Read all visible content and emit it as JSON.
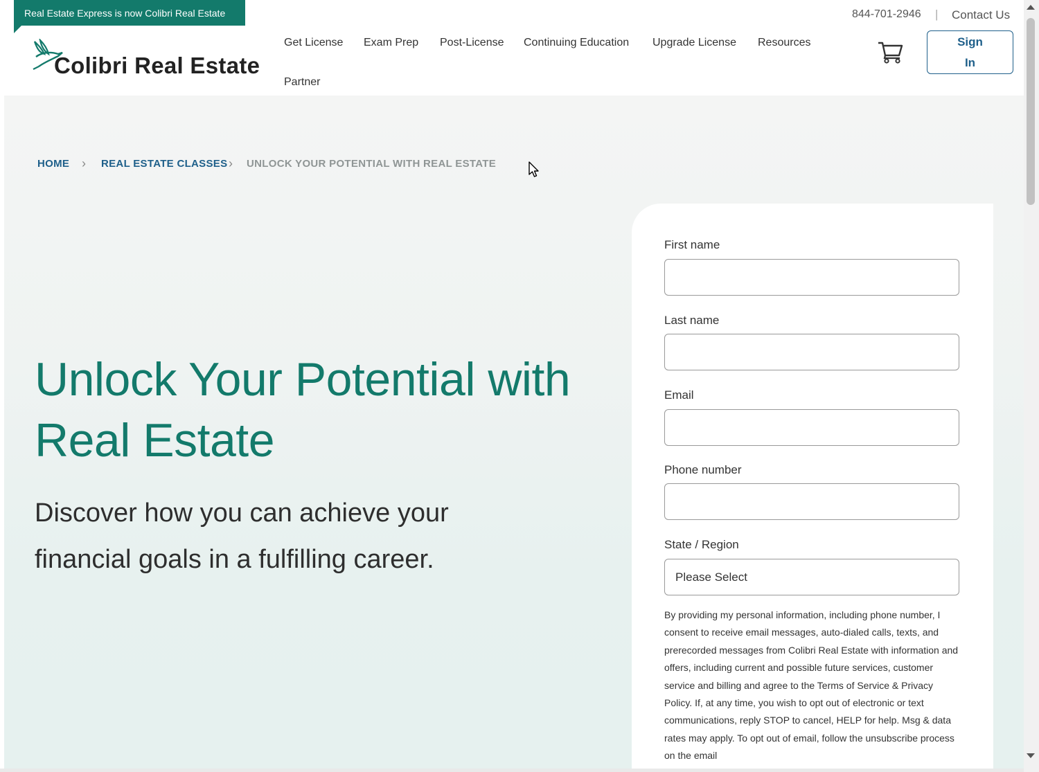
{
  "banner": {
    "text": "Real Estate Express is now Colibri Real Estate"
  },
  "logo": {
    "text": "Colibri Real Estate"
  },
  "nav": {
    "items": [
      {
        "label": "Get License"
      },
      {
        "label": "Exam Prep"
      },
      {
        "label": "Post-License"
      },
      {
        "label": "Continuing Education"
      },
      {
        "label": "Upgrade License"
      },
      {
        "label": "Resources"
      },
      {
        "label": "Partner"
      }
    ]
  },
  "utility": {
    "phone": "844-701-2946",
    "separator": "|",
    "contact": "Contact Us",
    "signin_line1": "Sign",
    "signin_line2": "In",
    "cart_icon": "cart-icon"
  },
  "breadcrumb": {
    "home": "HOME",
    "classes": "REAL ESTATE CLASSES",
    "current": "UNLOCK YOUR POTENTIAL WITH REAL ESTATE"
  },
  "hero": {
    "title_line1": "Unlock Your Potential with",
    "title_line2": "Real Estate",
    "subtitle_line1": "Discover how you can achieve your",
    "subtitle_line2": "financial goals in a fulfilling career."
  },
  "form": {
    "first_name_label": "First name",
    "last_name_label": "Last name",
    "email_label": "Email",
    "phone_label": "Phone number",
    "state_label": "State / Region",
    "state_value": "Please Select",
    "consent": "By providing my personal information, including phone number, I consent to receive email messages, auto-dialed calls, texts, and prerecorded messages from Colibri Real Estate with information and offers, including current and possible future services, customer service and billing and agree to the Terms of Service & Privacy Policy. If, at any time, you wish to opt out of electronic or text communications, reply STOP to cancel, HELP for help. Msg & data rates may apply. To opt out of email, follow the unsubscribe process on the email"
  },
  "colors": {
    "brand_green": "#137a6b",
    "link_blue": "#1e5f8a"
  }
}
